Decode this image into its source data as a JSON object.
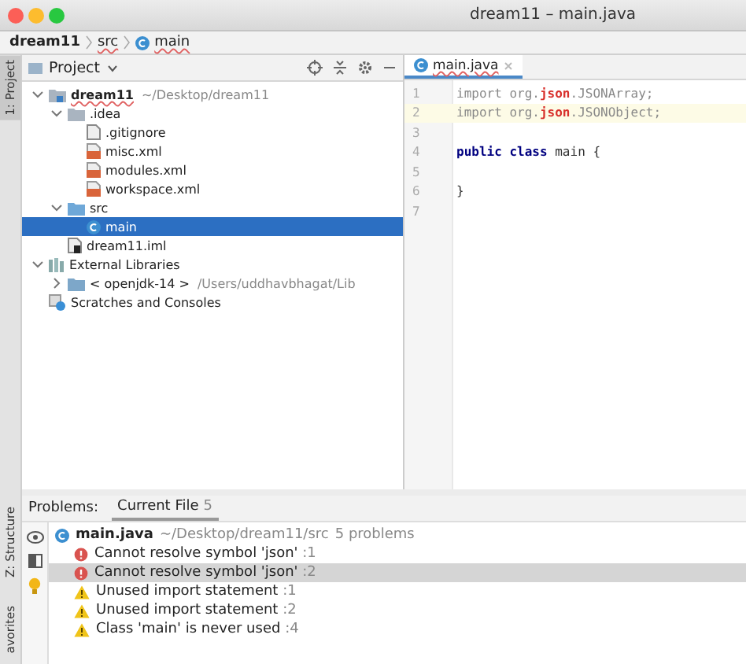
{
  "window": {
    "title": "dream11 – main.java"
  },
  "breadcrumb": [
    {
      "label": "dream11",
      "kind": "module"
    },
    {
      "label": "src",
      "kind": "folder"
    },
    {
      "label": "main",
      "kind": "class"
    }
  ],
  "side_tabs": [
    {
      "label": "1: Project",
      "selected": true
    },
    {
      "label": "Z: Structure",
      "selected": false
    },
    {
      "label": "avorites",
      "selected": false
    }
  ],
  "project_panel": {
    "title": "Project",
    "tree": [
      {
        "label": "dream11",
        "hint": "~/Desktop/dream11",
        "kind": "module",
        "expanded": true,
        "selected": false,
        "children": [
          {
            "label": ".idea",
            "kind": "folder",
            "expanded": true,
            "selected": false,
            "children": [
              {
                "label": ".gitignore",
                "kind": "file",
                "selected": false
              },
              {
                "label": "misc.xml",
                "kind": "xml",
                "selected": false
              },
              {
                "label": "modules.xml",
                "kind": "xml",
                "selected": false
              },
              {
                "label": "workspace.xml",
                "kind": "xml",
                "selected": false
              }
            ]
          },
          {
            "label": "src",
            "kind": "source",
            "expanded": true,
            "selected": false,
            "children": [
              {
                "label": "main",
                "kind": "class",
                "selected": true
              }
            ]
          },
          {
            "label": "dream11.iml",
            "kind": "iml",
            "selected": false
          }
        ]
      },
      {
        "label": "External Libraries",
        "kind": "libraries",
        "expanded": true,
        "selected": false,
        "children": [
          {
            "label": "< openjdk-14 >",
            "hint": "/Users/uddhavbhagat/Lib",
            "kind": "jdk",
            "expanded": false,
            "selected": false
          }
        ]
      },
      {
        "label": "Scratches and Consoles",
        "kind": "scratches",
        "selected": false
      }
    ]
  },
  "editor": {
    "tab": {
      "label": "main.java",
      "selected": true
    },
    "lines": [
      {
        "number": "1",
        "current": false,
        "tokens": [
          {
            "text": "import org.",
            "kind": "unused"
          },
          {
            "text": "json",
            "kind": "error"
          },
          {
            "text": ".JSONArray;",
            "kind": "unused"
          }
        ]
      },
      {
        "number": "2",
        "current": true,
        "tokens": [
          {
            "text": "import org.",
            "kind": "unused"
          },
          {
            "text": "json",
            "kind": "error"
          },
          {
            "text": ".JSONObject;",
            "kind": "unused"
          }
        ]
      },
      {
        "number": "3",
        "current": false
      },
      {
        "number": "4",
        "current": false,
        "tokens": [
          {
            "text": "public class",
            "kind": "keyword"
          },
          {
            "text": " main {",
            "kind": "plain"
          }
        ]
      },
      {
        "number": "5",
        "current": false
      },
      {
        "number": "6",
        "current": false,
        "tokens": [
          {
            "text": "}",
            "kind": "plain"
          }
        ]
      },
      {
        "number": "7",
        "current": false
      }
    ]
  },
  "problems": {
    "label": "Problems:",
    "tabs": [
      {
        "label": "Current File",
        "count": "5",
        "selected": true
      }
    ],
    "file": {
      "name": "main.java",
      "path": "~/Desktop/dream11/src",
      "summary": "5 problems"
    },
    "items": [
      {
        "kind": "error",
        "text": "Cannot resolve symbol 'json'",
        "line": ":1",
        "selected": false
      },
      {
        "kind": "error",
        "text": "Cannot resolve symbol 'json'",
        "line": ":2",
        "selected": true
      },
      {
        "kind": "warning",
        "text": "Unused import statement",
        "line": ":1",
        "selected": false
      },
      {
        "kind": "warning",
        "text": "Unused import statement",
        "line": ":2",
        "selected": false
      },
      {
        "kind": "warning",
        "text": "Class 'main' is never used",
        "line": ":4",
        "selected": false
      }
    ]
  }
}
